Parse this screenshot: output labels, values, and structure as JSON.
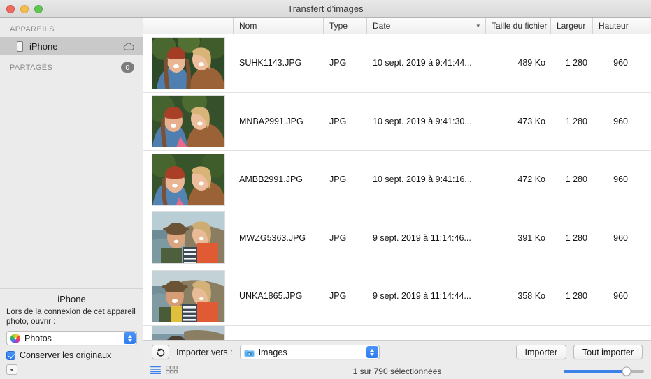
{
  "window": {
    "title": "Transfert d'images",
    "traffic_lights": [
      "close-button",
      "minimize-button",
      "zoom-button"
    ],
    "colors": {
      "accent": "#3b82e8",
      "selected_row": "#c9c9c9",
      "close": "#ed6a5e",
      "minimize": "#f5bd4f",
      "zoom": "#61c554"
    }
  },
  "sidebar": {
    "devices_header": "APPAREILS",
    "devices": [
      {
        "label": "iPhone",
        "icon": "iphone-icon",
        "accessory": "cloud-icon",
        "selected": true
      }
    ],
    "shared_header": "PARTAGÉS",
    "shared_count": "0",
    "info": {
      "device_name": "iPhone",
      "description": "Lors de la connexion de cet appareil photo, ouvrir :",
      "app_popup_value": "Photos",
      "app_popup_icon": "photos-app-icon",
      "keep_originals_label": "Conserver les originaux",
      "keep_originals_checked": true,
      "disclosure_icon": "disclosure-triangle-icon"
    }
  },
  "columns": [
    {
      "key": "thumb",
      "label": ""
    },
    {
      "key": "name",
      "label": "Nom"
    },
    {
      "key": "type",
      "label": "Type"
    },
    {
      "key": "date",
      "label": "Date",
      "sorted": true,
      "sort_arrow": "▾"
    },
    {
      "key": "size",
      "label": "Taille du fichier"
    },
    {
      "key": "width",
      "label": "Largeur"
    },
    {
      "key": "height",
      "label": "Hauteur"
    }
  ],
  "files": [
    {
      "name": "SUHK1143.JPG",
      "type": "JPG",
      "date": "10 sept. 2019 à 9:41:44...",
      "size": "489 Ko",
      "width": "1 280",
      "height": "960",
      "thumb": "two-women-green-foliage-1"
    },
    {
      "name": "MNBA2991.JPG",
      "type": "JPG",
      "date": "10 sept. 2019 à 9:41:30...",
      "size": "473 Ko",
      "width": "1 280",
      "height": "960",
      "thumb": "two-women-green-foliage-2"
    },
    {
      "name": "AMBB2991.JPG",
      "type": "JPG",
      "date": "10 sept. 2019 à 9:41:16...",
      "size": "472 Ko",
      "width": "1 280",
      "height": "960",
      "thumb": "two-women-green-foliage-3"
    },
    {
      "name": "MWZG5363.JPG",
      "type": "JPG",
      "date": "9 sept. 2019 à 11:14:46...",
      "size": "391 Ko",
      "width": "1 280",
      "height": "960",
      "thumb": "two-women-coast-1"
    },
    {
      "name": "UNKA1865.JPG",
      "type": "JPG",
      "date": "9 sept. 2019 à 11:14:44...",
      "size": "358 Ko",
      "width": "1 280",
      "height": "960",
      "thumb": "two-women-coast-2"
    }
  ],
  "toolbar": {
    "rotate_icon": "rotate-left-icon",
    "import_to_label": "Importer vers :",
    "destination_value": "Images",
    "destination_icon": "blue-camera-folder-icon",
    "import_button": "Importer",
    "import_all_button": "Tout importer"
  },
  "statusbar": {
    "list_view_icon": "list-view-icon",
    "grid_view_icon": "grid-view-icon",
    "active_view": "list",
    "status": "1 sur 790 sélectionnées",
    "zoom_slider_percent": 78
  }
}
